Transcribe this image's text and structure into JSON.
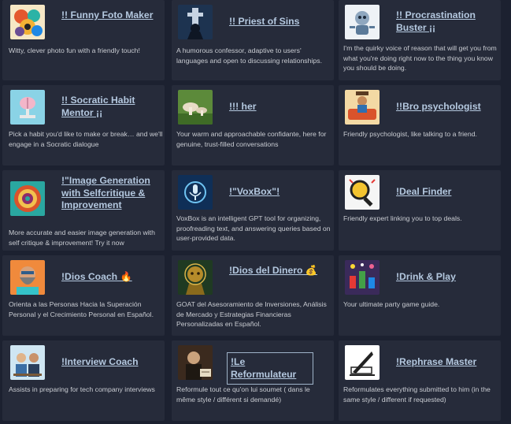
{
  "gpts": [
    {
      "title": "!! Funny Foto Maker",
      "description": "Witty, clever photo fun with a friendly touch!",
      "icon": "colorful-collage-icon"
    },
    {
      "title": "!! Priest of Sins",
      "description": "A humorous confessor, adaptive to users' languages and open to discussing relationships.",
      "icon": "church-priest-icon"
    },
    {
      "title": "!! Procrastination Buster ¡¡",
      "description": "I'm the quirky voice of reason that will get you from what you're doing right now to the thing you know you should be doing.",
      "icon": "robot-icon"
    },
    {
      "title": "!! Socratic Habit Mentor ¡¡",
      "description": "Pick a habit you'd like to make or break… and we'll engage in a Socratic dialogue",
      "icon": "brain-icon"
    },
    {
      "title": "!!! her",
      "description": "Your warm and approachable confidante, here for genuine, trust-filled conversations",
      "icon": "mushroom-icon"
    },
    {
      "title": "!!Bro psychologist",
      "description": "Friendly psychologist, like talking to a friend.",
      "icon": "couch-person-icon"
    },
    {
      "title": "!\"Image Generation with Selfcritique & Improvement",
      "description": "More accurate and easier image generation with self critique & improvement! Try it now",
      "icon": "circular-emblem-icon"
    },
    {
      "title": "!\"VoxBox\"!",
      "description": "VoxBox is an intelligent GPT tool for organizing, proofreading text, and answering queries based on user-provided data.",
      "icon": "microphone-icon"
    },
    {
      "title": "!Deal Finder",
      "description": "Friendly expert linking you to top deals.",
      "icon": "magnifier-icon"
    },
    {
      "title": "!Dios Coach 🔥",
      "description": "Orienta a las Personas Hacia la Superación Personal y el Crecimiento Personal en Español.",
      "icon": "bearded-man-icon"
    },
    {
      "title": "!Dios del Dinero 💰",
      "description": "GOAT del Asesoramiento de Inversiones, Análisis de Mercado y Estrategias Financieras Personalizadas en Español.",
      "icon": "golden-figure-icon"
    },
    {
      "title": "!Drink & Play",
      "description": "Your ultimate party game guide.",
      "icon": "party-collage-icon"
    },
    {
      "title": "!Interview Coach",
      "description": "Assists in preparing for tech company interviews",
      "icon": "interview-people-icon"
    },
    {
      "title": "!Le Reformulateur",
      "description": "Reformule tout ce qu'on lui soumet ( dans le même style / différent si demandé)",
      "icon": "writer-portrait-icon"
    },
    {
      "title": "!Rephrase Master",
      "description": "Reformulates everything submitted to him (in the same style / different if requested)",
      "icon": "quill-icon"
    }
  ]
}
